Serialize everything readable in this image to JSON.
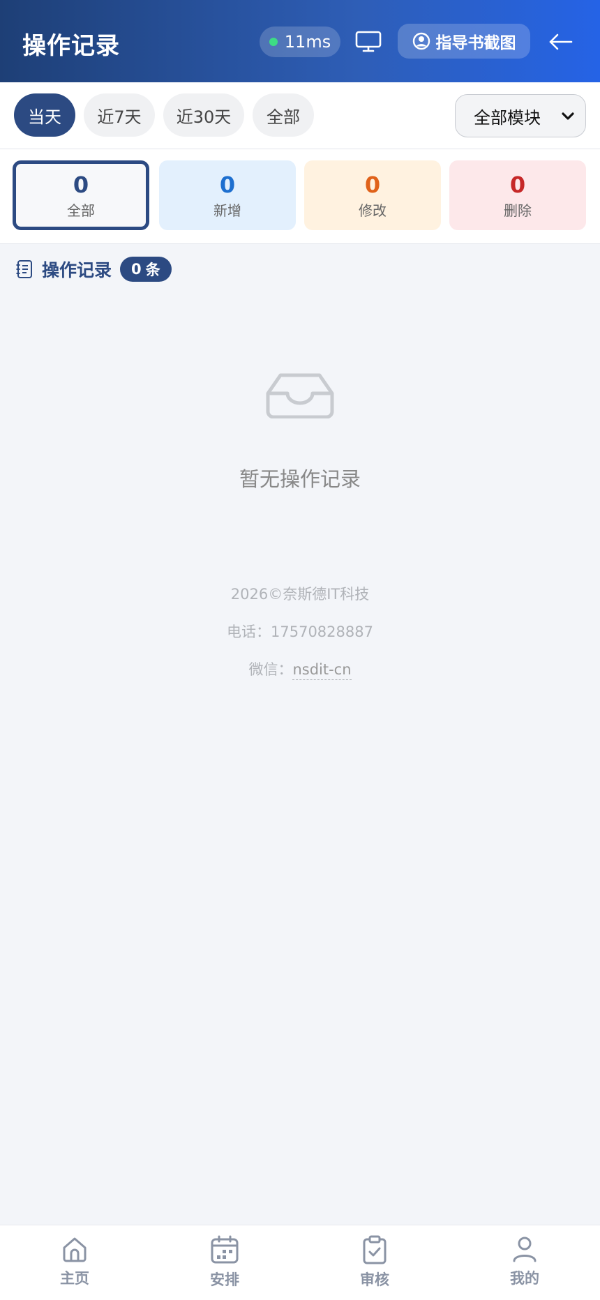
{
  "header": {
    "title": "操作记录",
    "ping": "11ms",
    "guide_label": "指导书截图"
  },
  "filters": {
    "chips": [
      {
        "label": "当天",
        "active": true
      },
      {
        "label": "近7天",
        "active": false
      },
      {
        "label": "近30天",
        "active": false
      },
      {
        "label": "全部",
        "active": false
      }
    ],
    "module_select": "全部模块"
  },
  "stats": [
    {
      "value": "0",
      "label": "全部"
    },
    {
      "value": "0",
      "label": "新增"
    },
    {
      "value": "0",
      "label": "修改"
    },
    {
      "value": "0",
      "label": "删除"
    }
  ],
  "section": {
    "title": "操作记录",
    "count": "0",
    "count_unit": "条"
  },
  "empty": {
    "text": "暂无操作记录"
  },
  "footer": {
    "copyright": "2026©奈斯德IT科技",
    "phone": "电话：17570828887",
    "wechat_label": "微信：",
    "wechat_id": "nsdit-cn"
  },
  "nav": [
    {
      "label": "主页",
      "icon": "home-icon"
    },
    {
      "label": "安排",
      "icon": "calendar-icon"
    },
    {
      "label": "审核",
      "icon": "clipboard-check-icon"
    },
    {
      "label": "我的",
      "icon": "user-icon"
    }
  ],
  "colors": {
    "primary": "#2c4a82",
    "header_gradient_start": "#1e3f76",
    "header_gradient_end": "#2563e6",
    "online_dot": "#3ddc84"
  }
}
